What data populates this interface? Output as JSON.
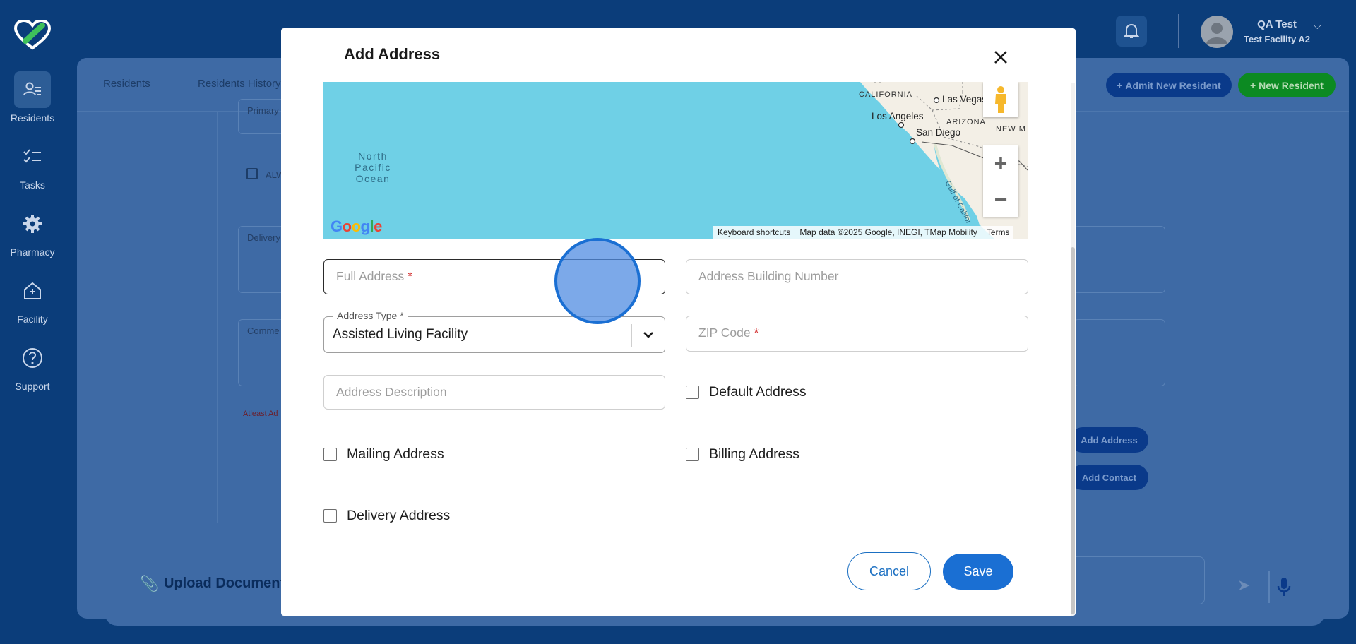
{
  "nav": {
    "items": [
      {
        "label": "Residents",
        "icon": "residents-icon",
        "active": true
      },
      {
        "label": "Tasks",
        "icon": "tasks-icon",
        "active": false
      },
      {
        "label": "Pharmacy",
        "icon": "gear-icon",
        "active": false
      },
      {
        "label": "Facility",
        "icon": "facility-icon",
        "active": false
      },
      {
        "label": "Support",
        "icon": "support-icon",
        "active": false
      }
    ]
  },
  "header": {
    "user_name": "QA Test",
    "facility": "Test Facility A2",
    "admit_label": "Admit New Resident",
    "new_resident_label": "New Resident"
  },
  "background": {
    "tabs": [
      "Residents",
      "Residents History"
    ],
    "primary_field": "Primary",
    "checkbox_label": "ALW",
    "delivery_field": "Delivery",
    "comment_field": "Comme",
    "note": "Atleast Ad",
    "add_address": "Add Address",
    "add_contact": "Add Contact",
    "upload_label": "Upload Document/"
  },
  "modal": {
    "title": "Add Address",
    "map": {
      "ocean": "North Pacific Ocean",
      "cities": [
        "Los Angeles",
        "Las Vegas",
        "San Diego"
      ],
      "states": [
        "CALIFORNIA",
        "ARIZONA",
        "NEW M"
      ],
      "gulf": "Gulf of Califor",
      "google_logo": "Google",
      "footer": {
        "shortcuts": "Keyboard shortcuts",
        "data": "Map data ©2025 Google, INEGI, TMap Mobility",
        "terms": "Terms"
      }
    },
    "fields": {
      "full_address": {
        "placeholder": "Full Address",
        "required": "*"
      },
      "building_number": {
        "placeholder": "Address Building Number"
      },
      "address_type": {
        "legend": "Address Type *",
        "value": "Assisted Living Facility"
      },
      "zip": {
        "placeholder": "ZIP Code",
        "required": "*"
      },
      "description": {
        "placeholder": "Address Description"
      }
    },
    "checkboxes": {
      "default": "Default Address",
      "mailing": "Mailing Address",
      "billing": "Billing Address",
      "delivery": "Delivery Address"
    },
    "cancel_label": "Cancel",
    "save_label": "Save"
  },
  "colors": {
    "brand": "#0b3d7a",
    "primary": "#1a6fd3",
    "success": "#0c8a22",
    "required": "#d32f2f"
  }
}
